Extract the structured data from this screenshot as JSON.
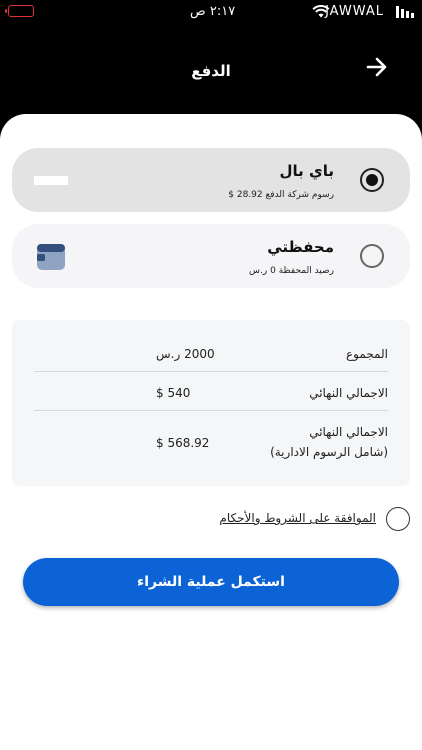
{
  "status_bar": {
    "time": "٢:١٧ ص",
    "carrier": "JAWWAL"
  },
  "header": {
    "title": "الدفع"
  },
  "payment_methods": [
    {
      "title": "باي بال",
      "subtitle": "رسوم شركة الدفع 28.92 $",
      "selected": true,
      "icon": "paypal-logo"
    },
    {
      "title": "محفظتي",
      "subtitle": "رصيد المحفظة 0 ر.س",
      "selected": false,
      "icon": "wallet-icon"
    }
  ],
  "summary": {
    "rows": [
      {
        "label": "المجموع",
        "value": "2000 ر.س"
      },
      {
        "label": "الاجمالي النهائي",
        "value": "540 $"
      },
      {
        "label": "الاجمالي النهائي",
        "label_line2": "(شامل الرسوم الادارية)",
        "value": "568.92 $"
      }
    ]
  },
  "terms": {
    "label": "الموافقة على الشروط والأحكام"
  },
  "actions": {
    "complete_purchase": "استكمل عملية الشراء"
  },
  "colors": {
    "primary_button": "#0b63d6",
    "header_bg": "#000000",
    "battery": "#e0303a"
  }
}
